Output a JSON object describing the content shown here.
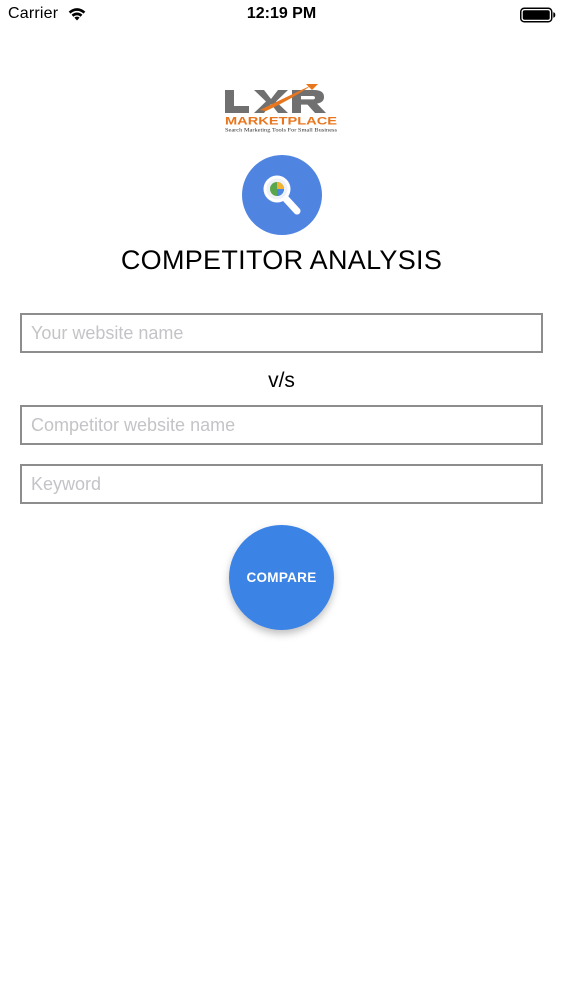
{
  "status_bar": {
    "carrier": "Carrier",
    "time": "12:19 PM"
  },
  "logo": {
    "wordmark": "LXR",
    "subtitle": "MARKETPLACE",
    "tagline": "Search Marketing Tools For Small Business"
  },
  "icons": {
    "analysis": "magnifier-pie-chart-icon",
    "wifi": "wifi-icon",
    "battery": "battery-icon"
  },
  "page": {
    "title": "COMPETITOR ANALYSIS"
  },
  "form": {
    "own_site_placeholder": "Your website name",
    "own_site_value": "",
    "versus_label": "v/s",
    "competitor_placeholder": "Competitor website name",
    "competitor_value": "",
    "keyword_placeholder": "Keyword",
    "keyword_value": "",
    "compare_label": "COMPARE"
  },
  "colors": {
    "accent": "#3c83e6",
    "icon_circle": "#4f84e1",
    "logo_orange": "#e8761e",
    "logo_gray": "#6b6b6b"
  }
}
